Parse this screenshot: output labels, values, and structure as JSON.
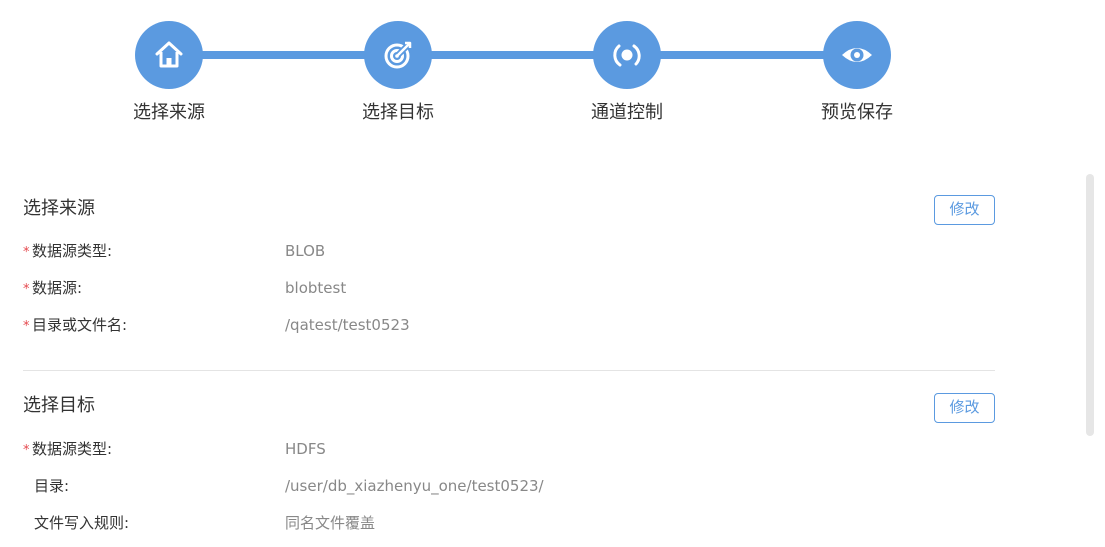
{
  "steps": [
    {
      "label": "选择来源",
      "icon": "home-icon"
    },
    {
      "label": "选择目标",
      "icon": "target-icon"
    },
    {
      "label": "通道控制",
      "icon": "channel-icon"
    },
    {
      "label": "预览保存",
      "icon": "eye-icon"
    }
  ],
  "colors": {
    "accent": "#5b9ae0",
    "required": "#e5484d",
    "value_text": "#888888"
  },
  "source": {
    "title": "选择来源",
    "edit_label": "修改",
    "fields": [
      {
        "label": "数据源类型:",
        "value": "BLOB",
        "required": true
      },
      {
        "label": "数据源:",
        "value": "blobtest",
        "required": true
      },
      {
        "label": "目录或文件名:",
        "value": "/qatest/test0523",
        "required": true
      }
    ]
  },
  "target": {
    "title": "选择目标",
    "edit_label": "修改",
    "fields": [
      {
        "label": "数据源类型:",
        "value": "HDFS",
        "required": true
      },
      {
        "label": "目录:",
        "value": "/user/db_xiazhenyu_one/test0523/",
        "required": false
      },
      {
        "label": "文件写入规则:",
        "value": "同名文件覆盖",
        "required": false
      }
    ]
  },
  "required_mark": "*"
}
